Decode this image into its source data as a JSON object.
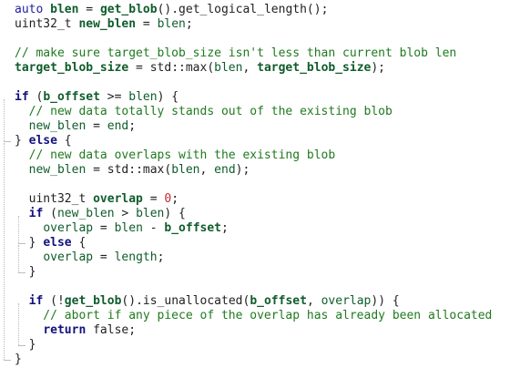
{
  "editor": {
    "lines": [
      [
        [
          "auto ",
          "kw"
        ],
        [
          "blen",
          "varb"
        ],
        [
          " = ",
          "plain"
        ],
        [
          "get_blob",
          "fn"
        ],
        [
          "().get_logical_length();",
          "plain"
        ]
      ],
      [
        [
          "uint32_t ",
          "plain"
        ],
        [
          "new_blen",
          "varb"
        ],
        [
          " = ",
          "plain"
        ],
        [
          "blen",
          "var"
        ],
        [
          ";",
          "plain"
        ]
      ],
      [],
      [
        [
          "// make sure target_blob_size isn't less than current blob len",
          "cm"
        ]
      ],
      [
        [
          "target_blob_size",
          "varb"
        ],
        [
          " = std::max(",
          "plain"
        ],
        [
          "blen",
          "var"
        ],
        [
          ", ",
          "plain"
        ],
        [
          "target_blob_size",
          "varb"
        ],
        [
          ");",
          "plain"
        ]
      ],
      [],
      [
        [
          "if",
          "kwb"
        ],
        [
          " (",
          "plain"
        ],
        [
          "b_offset",
          "varb"
        ],
        [
          " >= ",
          "plain"
        ],
        [
          "blen",
          "var"
        ],
        [
          ") {",
          "plain"
        ]
      ],
      [
        [
          "  // new data totally stands out of the existing blob",
          "cm"
        ]
      ],
      [
        [
          "  ",
          "plain"
        ],
        [
          "new_blen",
          "var"
        ],
        [
          " = ",
          "plain"
        ],
        [
          "end",
          "var"
        ],
        [
          ";",
          "plain"
        ]
      ],
      [
        [
          "} ",
          "plain"
        ],
        [
          "else",
          "kwb"
        ],
        [
          " {",
          "plain"
        ]
      ],
      [
        [
          "  // new data overlaps with the existing blob",
          "cm"
        ]
      ],
      [
        [
          "  ",
          "plain"
        ],
        [
          "new_blen",
          "var"
        ],
        [
          " = std::max(",
          "plain"
        ],
        [
          "blen",
          "var"
        ],
        [
          ", ",
          "plain"
        ],
        [
          "end",
          "var"
        ],
        [
          ");",
          "plain"
        ]
      ],
      [],
      [
        [
          "  uint32_t ",
          "plain"
        ],
        [
          "overlap",
          "varb"
        ],
        [
          " = ",
          "plain"
        ],
        [
          "0",
          "num"
        ],
        [
          ";",
          "plain"
        ]
      ],
      [
        [
          "  ",
          "plain"
        ],
        [
          "if",
          "kwb"
        ],
        [
          " (",
          "plain"
        ],
        [
          "new_blen",
          "var"
        ],
        [
          " > ",
          "plain"
        ],
        [
          "blen",
          "var"
        ],
        [
          ") {",
          "plain"
        ]
      ],
      [
        [
          "    ",
          "plain"
        ],
        [
          "overlap",
          "var"
        ],
        [
          " = ",
          "plain"
        ],
        [
          "blen",
          "var"
        ],
        [
          " - ",
          "plain"
        ],
        [
          "b_offset",
          "varb"
        ],
        [
          ";",
          "plain"
        ]
      ],
      [
        [
          "  } ",
          "plain"
        ],
        [
          "else",
          "kwb"
        ],
        [
          " {",
          "plain"
        ]
      ],
      [
        [
          "    ",
          "plain"
        ],
        [
          "overlap",
          "var"
        ],
        [
          " = ",
          "plain"
        ],
        [
          "length",
          "var"
        ],
        [
          ";",
          "plain"
        ]
      ],
      [
        [
          "  }",
          "plain"
        ]
      ],
      [],
      [
        [
          "  ",
          "plain"
        ],
        [
          "if",
          "kwb"
        ],
        [
          " (!",
          "plain"
        ],
        [
          "get_blob",
          "fn"
        ],
        [
          "().is_unallocated(",
          "plain"
        ],
        [
          "b_offset",
          "varb"
        ],
        [
          ", ",
          "plain"
        ],
        [
          "overlap",
          "var"
        ],
        [
          ")) {",
          "plain"
        ]
      ],
      [
        [
          "    // abort if any piece of the overlap has already been allocated",
          "cm"
        ]
      ],
      [
        [
          "    ",
          "plain"
        ],
        [
          "return",
          "kwb"
        ],
        [
          " false;",
          "plain"
        ]
      ],
      [
        [
          "  }",
          "plain"
        ]
      ],
      [
        [
          "}",
          "plain"
        ]
      ]
    ]
  }
}
